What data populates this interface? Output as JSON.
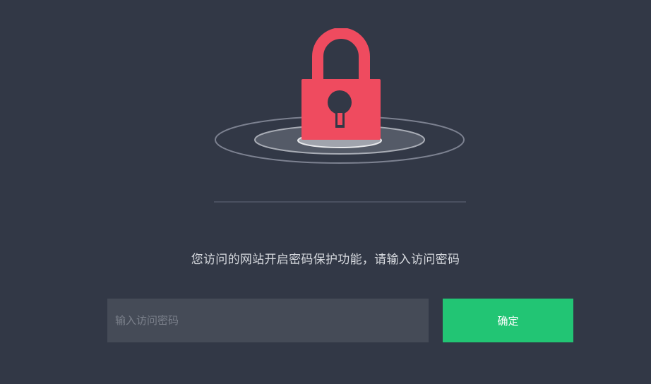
{
  "illustration": {
    "icon": "padlock-icon",
    "lock_color": "#ef4b5f",
    "keyhole_color": "#323846"
  },
  "prompt": {
    "message": "您访问的网站开启密码保护功能，请输入访问密码"
  },
  "form": {
    "password_value": "",
    "password_placeholder": "输入访问密码",
    "submit_label": "确定",
    "submit_color": "#22c574"
  }
}
